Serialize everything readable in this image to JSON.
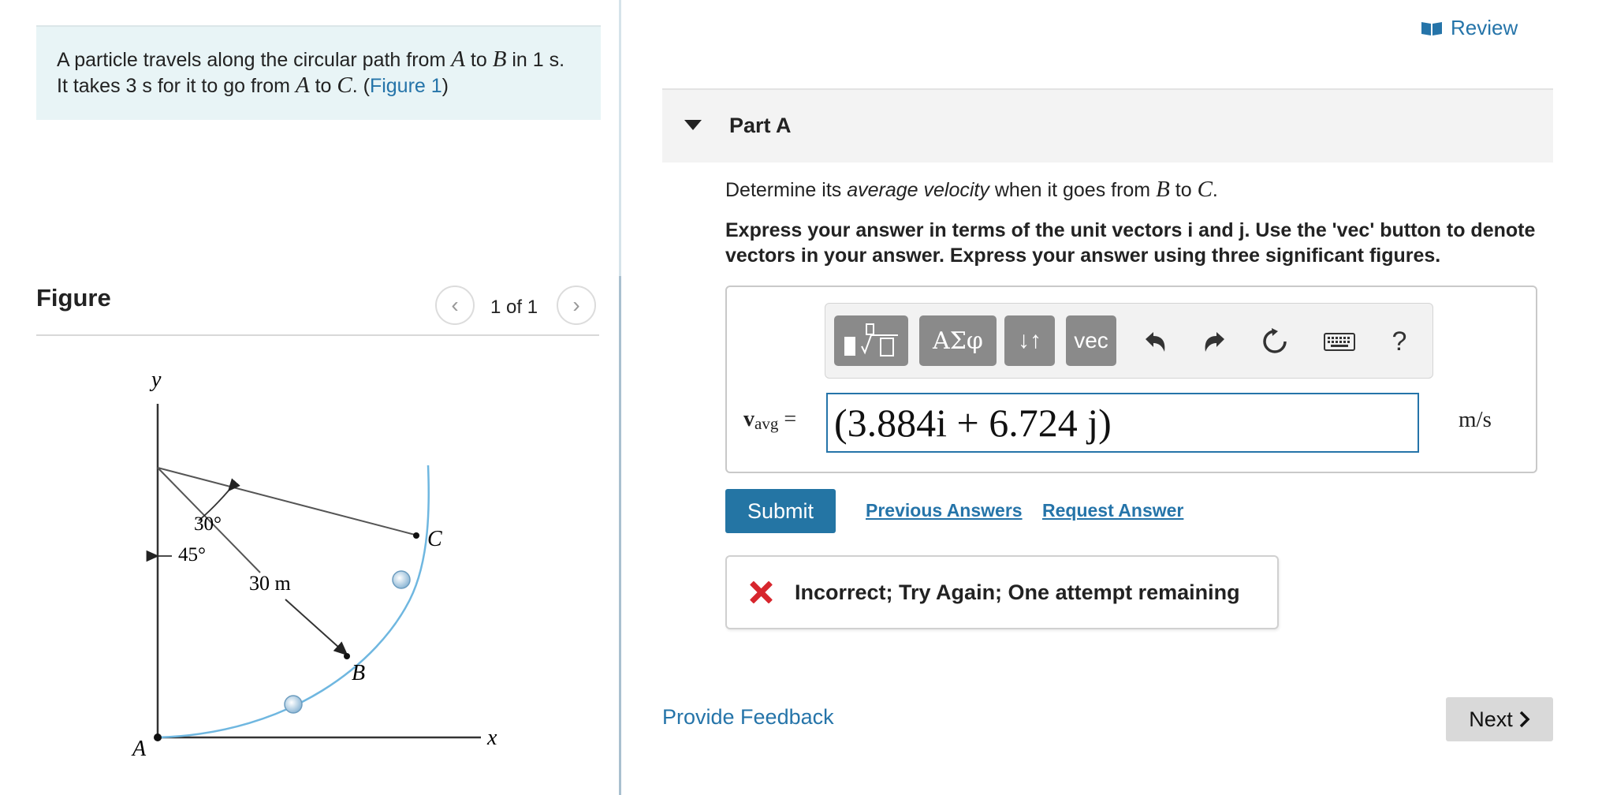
{
  "problem": {
    "text1": "A particle travels along the circular path from ",
    "var_a": "A",
    "text2": " to ",
    "var_b": "B",
    "text3": " in 1 s. It takes 3 s for it to go from ",
    "var_a2": "A",
    "text4": " to ",
    "var_c": "C",
    "text5": ". (",
    "figure_link": "Figure 1",
    "text6": ")"
  },
  "figure_panel": {
    "title": "Figure",
    "counter": "1 of 1",
    "prev_icon": "chevron-left-icon",
    "next_icon": "chevron-right-icon",
    "labels": {
      "y_axis": "y",
      "x_axis": "x",
      "angle_30": "30°",
      "angle_45": "45°",
      "radius": "30 m",
      "point_a": "A",
      "point_b": "B",
      "point_c": "C"
    }
  },
  "review": {
    "label": "Review",
    "icon": "book-icon"
  },
  "part": {
    "title": "Part A",
    "question_prefix": "Determine its ",
    "question_emph": "average velocity",
    "question_mid": " when it goes from ",
    "var_b": "B",
    "question_to": " to ",
    "var_c": "C",
    "question_end": ".",
    "instructions": "Express your answer in terms of the unit vectors i and j. Use the 'vec' button to denote vectors in your answer. Express your answer using three significant figures."
  },
  "toolbar": {
    "greek_label": "ΑΣφ",
    "arrows_label": "↓↑",
    "vec_label": "vec",
    "help_label": "?",
    "undo_icon": "undo-icon",
    "redo_icon": "redo-icon",
    "reset_icon": "reset-icon",
    "keyboard_icon": "keyboard-icon"
  },
  "answer": {
    "label_v": "v",
    "label_sub": "avg",
    "label_eq": " =",
    "value": "(3.884i + 6.724 j)",
    "units": "m/s"
  },
  "actions": {
    "submit": "Submit",
    "previous_answers": "Previous Answers",
    "request_answer": "Request Answer"
  },
  "feedback": {
    "message": "Incorrect; Try Again; One attempt remaining"
  },
  "footer": {
    "provide_feedback": "Provide Feedback",
    "next": "Next"
  },
  "colors": {
    "link": "#2574a9",
    "submit": "#2475a4",
    "error": "#d7262d",
    "problem_bg": "#e8f4f6",
    "path": "#6fb7e0"
  }
}
